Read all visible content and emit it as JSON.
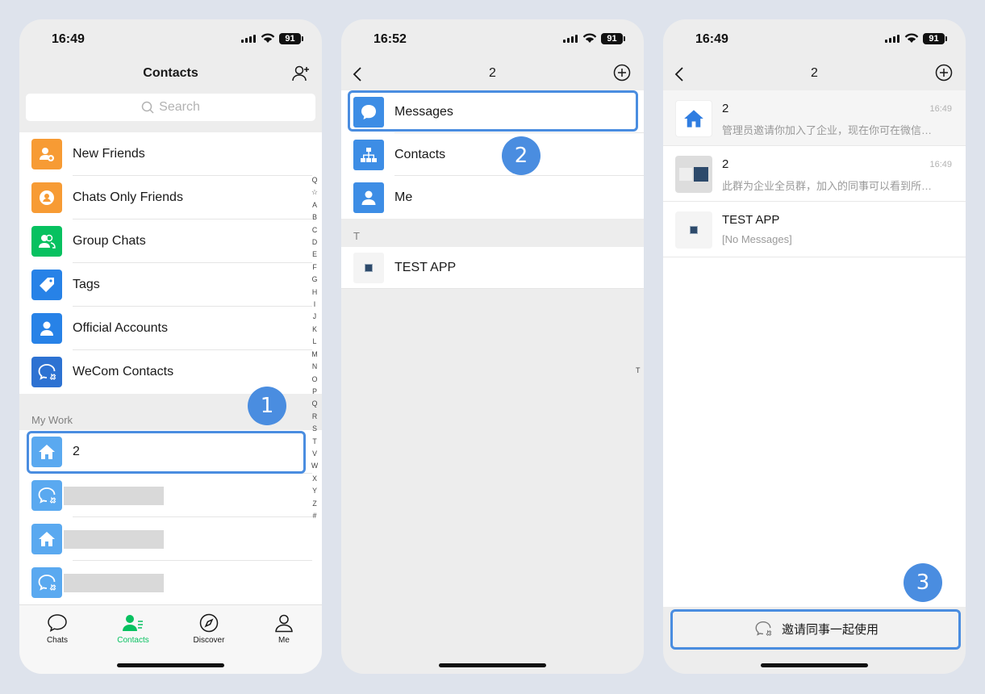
{
  "phone1": {
    "time": "16:49",
    "battery": "91",
    "title": "Contacts",
    "search_placeholder": "Search",
    "items": [
      {
        "label": "New Friends",
        "color": "#f79b34",
        "icon": "add-friend-icon"
      },
      {
        "label": "Chats Only Friends",
        "color": "#f79b34",
        "icon": "chats-only-icon"
      },
      {
        "label": "Group Chats",
        "color": "#07c160",
        "icon": "group-icon"
      },
      {
        "label": "Tags",
        "color": "#2782e7",
        "icon": "tag-icon"
      },
      {
        "label": "Official Accounts",
        "color": "#2782e7",
        "icon": "official-account-icon"
      },
      {
        "label": "WeCom Contacts",
        "color": "#2d72d2",
        "icon": "wecom-icon"
      }
    ],
    "section_label": "My Work",
    "work_items": [
      {
        "label": "2",
        "icon": "home-icon",
        "color": "#5aa9f0"
      },
      {
        "label": "",
        "icon": "wecom-icon",
        "color": "#5aa9f0"
      },
      {
        "label": "",
        "icon": "home-icon",
        "color": "#5aa9f0"
      },
      {
        "label": "",
        "icon": "wecom-icon",
        "color": "#5aa9f0"
      }
    ],
    "index_letters": [
      "Q",
      "☆",
      "A",
      "B",
      "C",
      "D",
      "E",
      "F",
      "G",
      "H",
      "I",
      "J",
      "K",
      "L",
      "M",
      "N",
      "O",
      "P",
      "Q",
      "R",
      "S",
      "T",
      "V",
      "W",
      "X",
      "Y",
      "Z",
      "#"
    ],
    "tabs": [
      {
        "label": "Chats",
        "icon": "chat-bubble-icon",
        "active": false
      },
      {
        "label": "Contacts",
        "icon": "contacts-icon",
        "active": true
      },
      {
        "label": "Discover",
        "icon": "compass-icon",
        "active": false
      },
      {
        "label": "Me",
        "icon": "person-icon",
        "active": false
      }
    ],
    "step": "1"
  },
  "phone2": {
    "time": "16:52",
    "battery": "91",
    "title": "2",
    "items": [
      {
        "label": "Messages",
        "icon": "message-icon",
        "color": "#3d8de5"
      },
      {
        "label": "Contacts",
        "icon": "org-chart-icon",
        "color": "#3d8de5"
      },
      {
        "label": "Me",
        "icon": "person-icon",
        "color": "#3d8de5"
      }
    ],
    "section_label": "T",
    "app_item": "TEST APP",
    "side_letter": "T",
    "step": "2"
  },
  "phone3": {
    "time": "16:49",
    "battery": "91",
    "title": "2",
    "conversations": [
      {
        "name": "2",
        "time": "16:49",
        "preview": "管理员邀请你加入了企业，现在你可在微信…"
      },
      {
        "name": "2",
        "time": "16:49",
        "preview": "此群为企业全员群，加入的同事可以看到所…"
      },
      {
        "name": "TEST APP",
        "time": "",
        "preview": "[No Messages]"
      }
    ],
    "invite_label": "邀请同事一起使用",
    "step": "3"
  },
  "colors": {
    "highlight": "#4a8de0",
    "wechat_green": "#07c160"
  }
}
